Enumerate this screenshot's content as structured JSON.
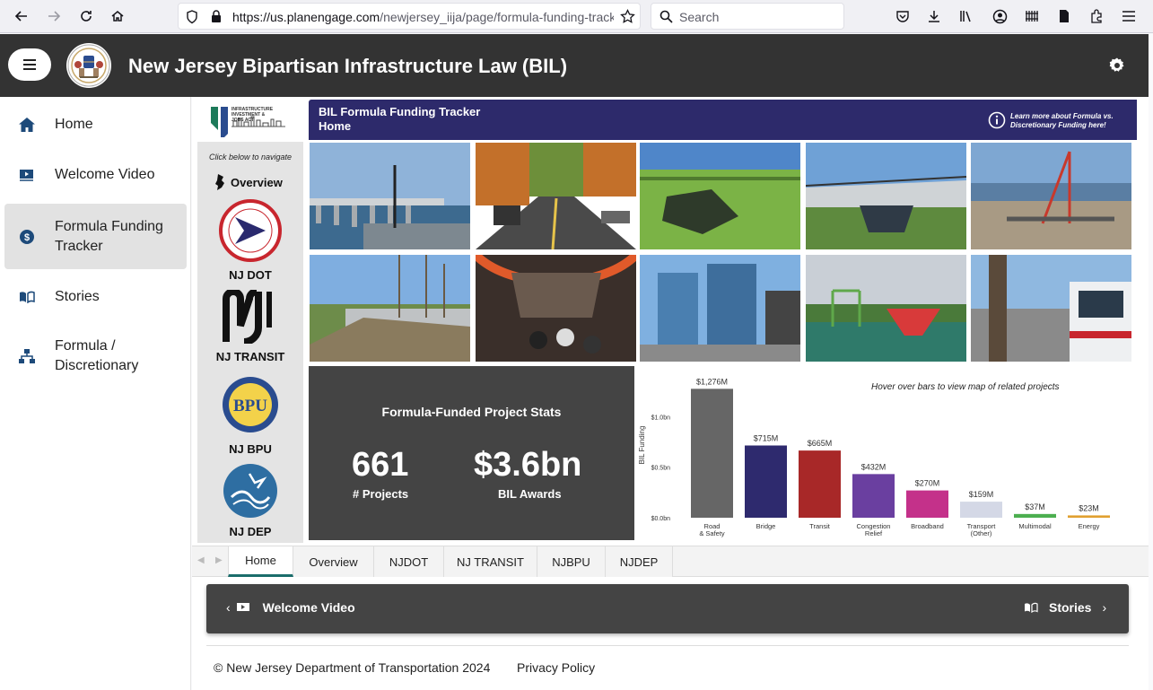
{
  "browser": {
    "url_host": "https://us.planengage.com",
    "url_path": "/newjersey_iija/page/formula-funding-track",
    "search_placeholder": "Search"
  },
  "header": {
    "title": "New Jersey Bipartisan Infrastructure Law (BIL)"
  },
  "sidebar": {
    "items": [
      {
        "label": "Home",
        "icon": "home-icon"
      },
      {
        "label": "Welcome Video",
        "icon": "video-icon"
      },
      {
        "label": "Formula Funding Tracker",
        "icon": "dollar-icon"
      },
      {
        "label": "Stories",
        "icon": "book-icon"
      },
      {
        "label": "Formula / Discretionary",
        "icon": "hierarchy-icon"
      }
    ]
  },
  "left_nav": {
    "hint": "Click below to navigate",
    "overview": "Overview",
    "orgs": [
      "NJ DOT",
      "NJ TRANSIT",
      "NJ BPU",
      "NJ DEP"
    ]
  },
  "banner": {
    "line1": "BIL Formula Funding Tracker",
    "line2": "Home",
    "info_text": "Learn more about Formula vs. Discretionary Funding here!"
  },
  "stats": {
    "title": "Formula-Funded Project Stats",
    "projects_value": "661",
    "projects_label": "# Projects",
    "awards_value": "$3.6bn",
    "awards_label": "BIL Awards"
  },
  "chart_hint": "Hover over bars to view map of related projects",
  "chart_data": {
    "type": "bar",
    "ylabel": "BIL Funding",
    "yticks": [
      "$0.0bn",
      "$0.5bn",
      "$1.0bn"
    ],
    "ylim": [
      0,
      1.35
    ],
    "categories": [
      "Road & Safety",
      "Bridge",
      "Transit",
      "Congestion Relief",
      "Broadband",
      "Transport (Other)",
      "Multimodal",
      "Energy"
    ],
    "values": [
      1.276,
      0.715,
      0.665,
      0.432,
      0.27,
      0.159,
      0.037,
      0.023
    ],
    "labels": [
      "$1,276M",
      "$715M",
      "$665M",
      "$432M",
      "$270M",
      "$159M",
      "$37M",
      "$23M"
    ],
    "colors": [
      "#666666",
      "#2e2a6e",
      "#a82828",
      "#6a3fa0",
      "#c4318a",
      "#d4d8e6",
      "#4caf50",
      "#e0a030"
    ]
  },
  "tabs": [
    "Home",
    "Overview",
    "NJDOT",
    "NJ TRANSIT",
    "NJBPU",
    "NJDEP"
  ],
  "pager": {
    "prev": "Welcome Video",
    "next": "Stories"
  },
  "footer": {
    "copyright": "© New Jersey Department of Transportation 2024",
    "privacy": "Privacy Policy"
  }
}
